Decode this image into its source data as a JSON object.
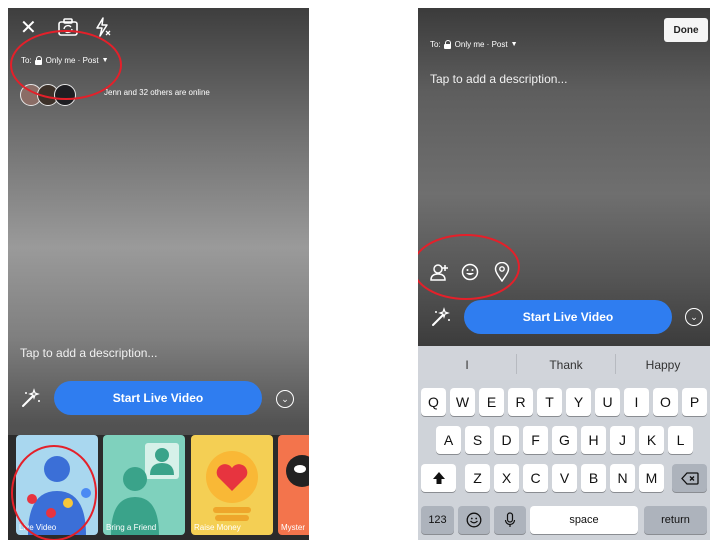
{
  "left": {
    "audience": {
      "to": "To:",
      "value": "Only me · Post"
    },
    "online_text": "Jenn and 32 others are online",
    "description_placeholder": "Tap to add a description...",
    "start_button": "Start Live Video",
    "cards": [
      {
        "label": "Live Video"
      },
      {
        "label": "Bring a Friend"
      },
      {
        "label": "Raise Money"
      },
      {
        "label": "Myster"
      }
    ]
  },
  "right": {
    "done_label": "Done",
    "audience": {
      "to": "To:",
      "value": "Only me · Post"
    },
    "description_placeholder": "Tap to add a description...",
    "start_button": "Start Live Video",
    "suggestions": [
      "I",
      "Thank",
      "Happy"
    ],
    "keyboard": {
      "row1": [
        "Q",
        "W",
        "E",
        "R",
        "T",
        "Y",
        "U",
        "I",
        "O",
        "P"
      ],
      "row2": [
        "A",
        "S",
        "D",
        "F",
        "G",
        "H",
        "J",
        "K",
        "L"
      ],
      "row3": [
        "Z",
        "X",
        "C",
        "V",
        "B",
        "N",
        "M"
      ],
      "num_key": "123",
      "space_key": "space",
      "return_key": "return"
    }
  },
  "icons": {
    "close": "close-icon",
    "camera_flip": "camera-flip-icon",
    "flash_off": "flash-off-icon",
    "magic_wand": "magic-wand-icon",
    "tag_people": "tag-people-icon",
    "emoji": "emoji-icon",
    "location": "location-icon"
  },
  "colors": {
    "primary": "#2f7df0",
    "highlight_ring": "#e4202a"
  }
}
